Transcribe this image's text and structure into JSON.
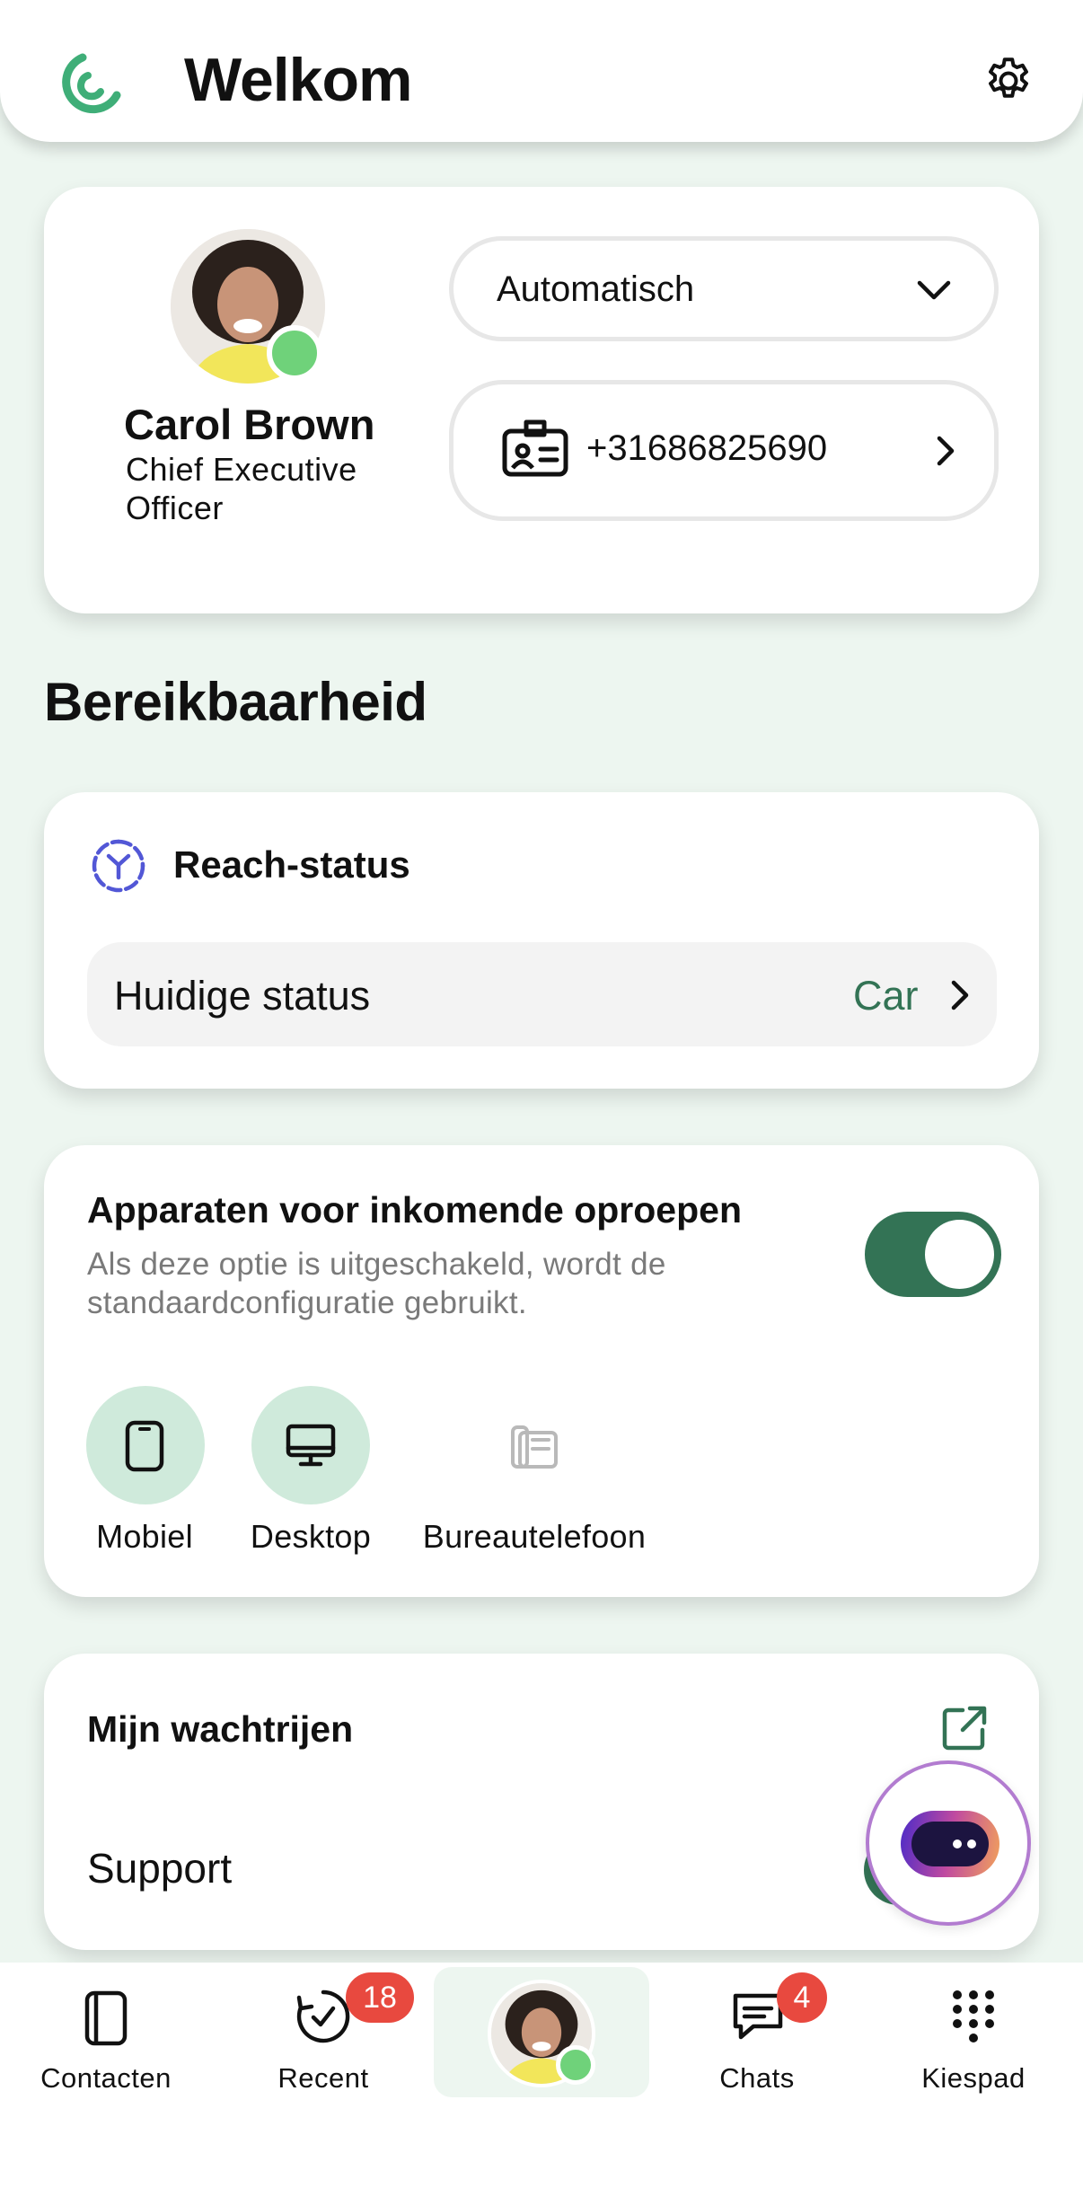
{
  "header": {
    "title": "Welkom",
    "logo_icon": "app-logo-icon",
    "settings_icon": "gear-icon"
  },
  "profile": {
    "name": "Carol Brown",
    "job_title": "Chief Executive Officer",
    "presence": "available",
    "presence_color": "#6fd27a",
    "mode_select": {
      "value": "Automatisch",
      "icon": "chevron-down-icon"
    },
    "caller_id": {
      "value": "+31686825690",
      "icon": "id-card-icon"
    }
  },
  "reachability": {
    "title": "Bereikbaarheid",
    "reach_status": {
      "heading": "Reach-status",
      "icon": "reach-status-icon",
      "row_label": "Huidige status",
      "row_value": "Car"
    }
  },
  "devices": {
    "heading": "Apparaten voor inkomende oproepen",
    "description": "Als deze optie is uitgeschakeld, wordt de standaardconfiguratie gebruikt.",
    "toggle_on": true,
    "items": [
      {
        "label": "Mobiel",
        "icon": "mobile-phone-icon",
        "active": true
      },
      {
        "label": "Desktop",
        "icon": "desktop-icon",
        "active": true
      },
      {
        "label": "Bureautelefoon",
        "icon": "desk-phone-icon",
        "active": false
      }
    ]
  },
  "queues": {
    "heading": "Mijn wachtrijen",
    "icon": "external-link-icon",
    "items": [
      {
        "label": "Support"
      }
    ]
  },
  "assistant": {
    "icon": "assistant-bot-icon"
  },
  "nav": {
    "items": [
      {
        "label": "Contacten",
        "icon": "contacts-icon"
      },
      {
        "label": "Recent",
        "icon": "recent-calls-icon",
        "badge": "18"
      },
      {
        "label": "",
        "icon": "profile-avatar"
      },
      {
        "label": "Chats",
        "icon": "chat-icon",
        "badge": "4"
      },
      {
        "label": "Kiespad",
        "icon": "keypad-icon"
      }
    ]
  },
  "colors": {
    "accent_green": "#337355",
    "brand_green": "#3fae78",
    "background": "#edf6f0",
    "badge_red": "#e8493f",
    "device_active_bg": "#cfeadb",
    "reach_icon_blue": "#5257d6"
  }
}
